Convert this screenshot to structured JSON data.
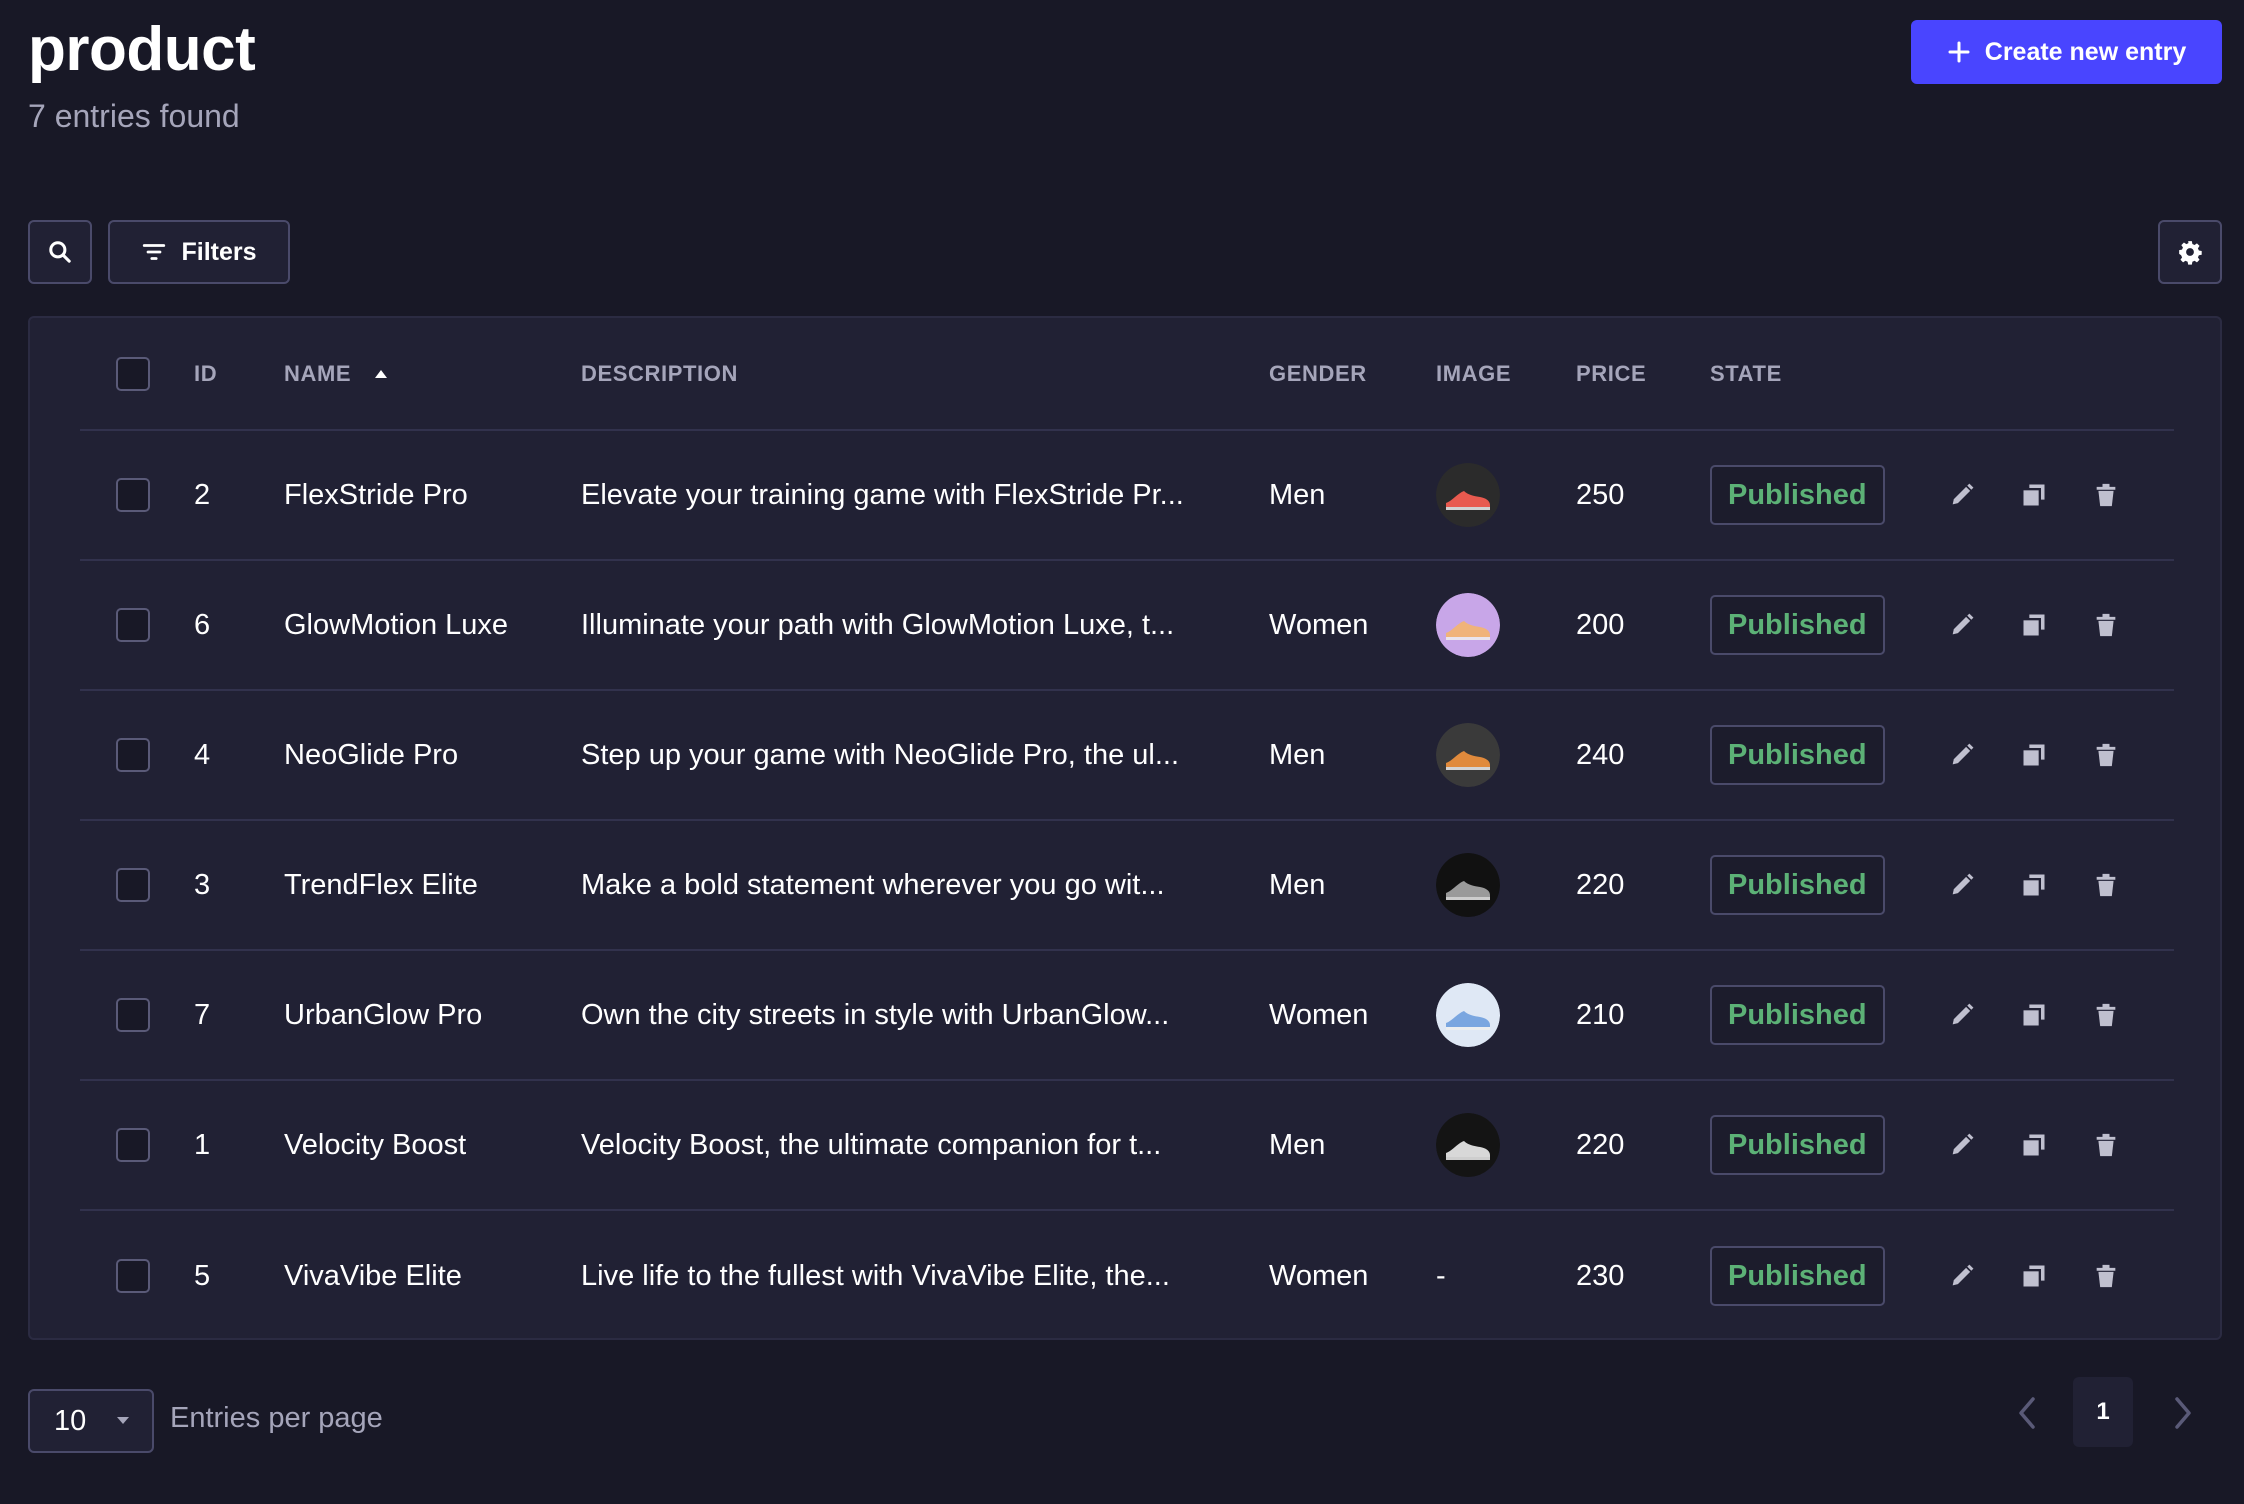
{
  "header": {
    "title": "product",
    "subtitle": "7 entries found",
    "create_label": "Create new entry"
  },
  "toolbar": {
    "filters_label": "Filters"
  },
  "table": {
    "columns": {
      "id": "ID",
      "name": "NAME",
      "description": "DESCRIPTION",
      "gender": "GENDER",
      "image": "IMAGE",
      "price": "PRICE",
      "state": "STATE"
    },
    "sort": {
      "column": "NAME",
      "direction": "ascending"
    },
    "rows": [
      {
        "id": "2",
        "name": "FlexStride Pro",
        "description": "Elevate your training game with FlexStride Pr...",
        "gender": "Men",
        "image": "shoe-thumbnail",
        "price": "250",
        "state": "Published"
      },
      {
        "id": "6",
        "name": "GlowMotion Luxe",
        "description": "Illuminate your path with GlowMotion Luxe, t...",
        "gender": "Women",
        "image": "shoe-thumbnail",
        "price": "200",
        "state": "Published"
      },
      {
        "id": "4",
        "name": "NeoGlide Pro",
        "description": "Step up your game with NeoGlide Pro, the ul...",
        "gender": "Men",
        "image": "shoe-thumbnail",
        "price": "240",
        "state": "Published"
      },
      {
        "id": "3",
        "name": "TrendFlex Elite",
        "description": "Make a bold statement wherever you go wit...",
        "gender": "Men",
        "image": "shoe-thumbnail",
        "price": "220",
        "state": "Published"
      },
      {
        "id": "7",
        "name": "UrbanGlow Pro",
        "description": "Own the city streets in style with UrbanGlow...",
        "gender": "Women",
        "image": "shoe-thumbnail",
        "price": "210",
        "state": "Published"
      },
      {
        "id": "1",
        "name": "Velocity Boost",
        "description": "Velocity Boost, the ultimate companion for t...",
        "gender": "Men",
        "image": "shoe-thumbnail",
        "price": "220",
        "state": "Published"
      },
      {
        "id": "5",
        "name": "VivaVibe Elite",
        "description": "Live life to the fullest with VivaVibe Elite, the...",
        "gender": "Women",
        "image": "-",
        "price": "230",
        "state": "Published"
      }
    ]
  },
  "footer": {
    "per_page_value": "10",
    "per_page_label": "Entries per page",
    "current_page": "1"
  },
  "icons": {
    "create": "plus-icon",
    "search": "search-icon",
    "filters": "filter-icon",
    "settings": "gear-icon",
    "sort": "sort-ascending-icon",
    "edit": "pencil-icon",
    "duplicate": "duplicate-icon",
    "delete": "trash-icon",
    "per_page_caret": "caret-down-icon",
    "prev": "chevron-left-icon",
    "next": "chevron-right-icon"
  },
  "colors": {
    "background": "#181826",
    "surface": "#212134",
    "border": "#4a4a6a",
    "primary": "#4945ff",
    "muted_text": "#a5a5ba",
    "published": "#5cb176"
  }
}
